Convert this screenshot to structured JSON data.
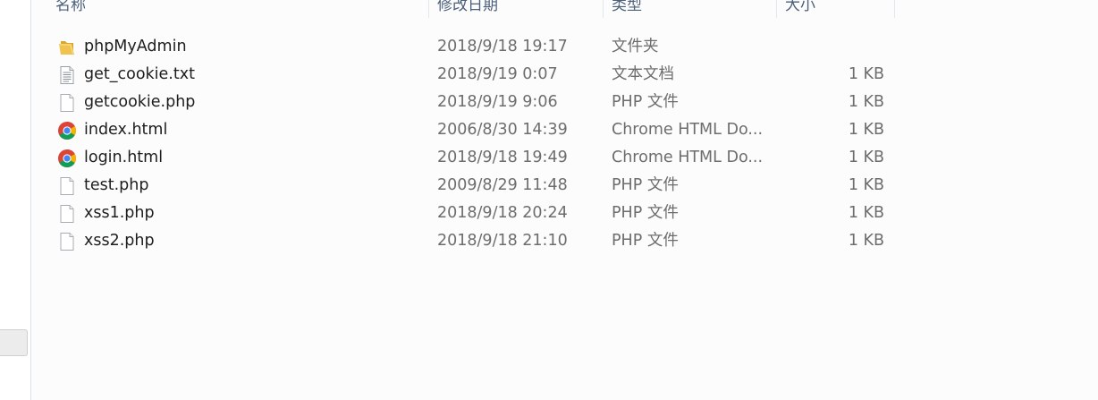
{
  "columns": {
    "name": "名称",
    "modified": "修改日期",
    "type": "类型",
    "size": "大小"
  },
  "files": [
    {
      "name": "phpMyAdmin",
      "modified": "2018/9/18 19:17",
      "type": "文件夹",
      "size": "",
      "icon": "folder-icon"
    },
    {
      "name": "get_cookie.txt",
      "modified": "2018/9/19 0:07",
      "type": "文本文档",
      "size": "1 KB",
      "icon": "text-file-icon"
    },
    {
      "name": "getcookie.php",
      "modified": "2018/9/19 9:06",
      "type": "PHP 文件",
      "size": "1 KB",
      "icon": "blank-file-icon"
    },
    {
      "name": "index.html",
      "modified": "2006/8/30 14:39",
      "type": "Chrome HTML Do...",
      "size": "1 KB",
      "icon": "chrome-icon"
    },
    {
      "name": "login.html",
      "modified": "2018/9/18 19:49",
      "type": "Chrome HTML Do...",
      "size": "1 KB",
      "icon": "chrome-icon"
    },
    {
      "name": "test.php",
      "modified": "2009/8/29 11:48",
      "type": "PHP 文件",
      "size": "1 KB",
      "icon": "blank-file-icon"
    },
    {
      "name": "xss1.php",
      "modified": "2018/9/18 20:24",
      "type": "PHP 文件",
      "size": "1 KB",
      "icon": "blank-file-icon"
    },
    {
      "name": "xss2.php",
      "modified": "2018/9/18 21:10",
      "type": "PHP 文件",
      "size": "1 KB",
      "icon": "blank-file-icon"
    }
  ],
  "colors": {
    "header_text": "#4c607a",
    "folder": "#f0c24e",
    "chrome_red": "#db4437",
    "chrome_green": "#0f9d58",
    "chrome_yellow": "#f4b400",
    "chrome_blue": "#4285f4"
  }
}
